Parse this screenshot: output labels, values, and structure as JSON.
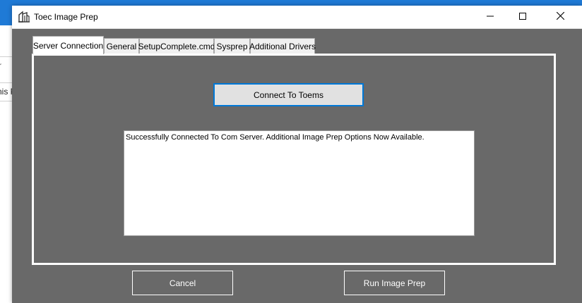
{
  "window": {
    "title": "Toec Image Prep",
    "icon": "building-icon",
    "controls": {
      "minimize_icon": "minimize-icon",
      "maximize_icon": "maximize-icon",
      "close_icon": "close-icon"
    }
  },
  "background_app": {
    "text_fragment": "nis P",
    "bracket_fragment": "r"
  },
  "tabs": [
    {
      "label": "Server Connection",
      "selected": true
    },
    {
      "label": "General",
      "selected": false
    },
    {
      "label": "SetupComplete.cmd",
      "selected": false
    },
    {
      "label": "Sysprep",
      "selected": false
    },
    {
      "label": "Additional Drivers",
      "selected": false
    }
  ],
  "server_connection": {
    "connect_button_label": "Connect To Toems",
    "log_text": "Successfully Connected To Com Server.  Additional Image Prep Options Now Available."
  },
  "footer": {
    "cancel_label": "Cancel",
    "run_label": "Run Image Prep"
  },
  "colors": {
    "window_background": "#696969",
    "focus_border": "#0078d7",
    "taskbar_accent": "#1f7ad6"
  }
}
